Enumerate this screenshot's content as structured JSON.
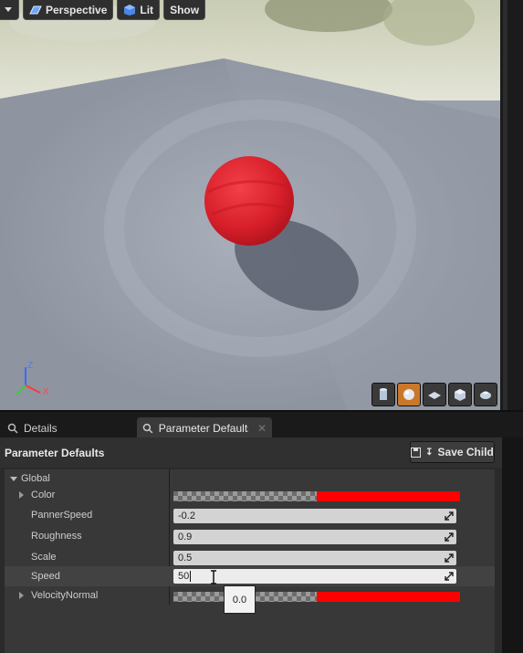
{
  "viewport_toolbar": {
    "perspective_label": "Perspective",
    "lit_label": "Lit",
    "show_label": "Show"
  },
  "axis_gizmo": {
    "x": "X",
    "z": "Z"
  },
  "tabs": [
    {
      "label": "Details"
    },
    {
      "label": "Parameter Defaults"
    }
  ],
  "panel": {
    "title": "Parameter Defaults",
    "save_child_label": "Save Child",
    "group_label": "Global",
    "params": [
      {
        "name": "Color",
        "type": "color"
      },
      {
        "name": "PannerSpeed",
        "value": "-0.2"
      },
      {
        "name": "Roughness",
        "value": "0.9"
      },
      {
        "name": "Scale",
        "value": "0.5"
      },
      {
        "name": "Speed",
        "value": "50"
      },
      {
        "name": "VelocityNormal",
        "type": "color"
      }
    ],
    "tooltip": "0.0"
  },
  "colors": {
    "accent_orange": "#c9782a",
    "color_swatch": "#ff0000",
    "sphere": "#e0262f"
  }
}
